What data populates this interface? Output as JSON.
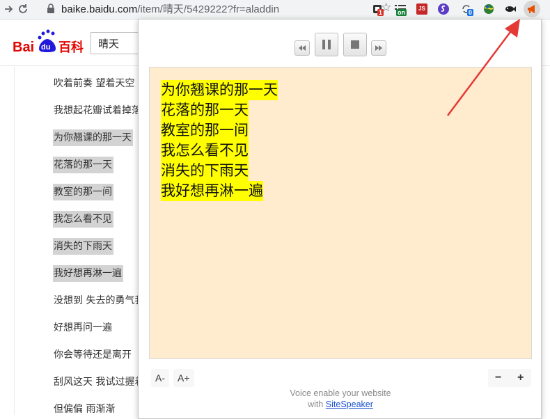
{
  "browser": {
    "url_domain": "baike.baidu.com",
    "url_path": "/item/晴天/5429222?fr=aladdin",
    "extensions": [
      {
        "icon": "mail-extension-icon",
        "badge": "1",
        "badge_color": "#d93025"
      },
      {
        "icon": "list-extension-icon",
        "badge": "on",
        "badge_color": "#188038"
      },
      {
        "icon": "js-extension-icon",
        "label": "JS",
        "color": "#c62828"
      },
      {
        "icon": "s-extension-icon",
        "color": "#5b3cc4"
      },
      {
        "icon": "refresh-extension-icon",
        "badge": "0",
        "badge_color": "#1a73e8"
      },
      {
        "icon": "globe-extension-icon"
      },
      {
        "icon": "fish-extension-icon"
      },
      {
        "icon": "megaphone-extension-icon",
        "color": "#e65100"
      }
    ]
  },
  "baidu": {
    "logo_text_latin_1": "Bai",
    "logo_text_du": "du",
    "logo_text_chinese": "百科",
    "search_value": "晴天",
    "lyrics": [
      {
        "text": "吹着前奏 望着天空",
        "highlighted": false
      },
      {
        "text": "我想起花瓣试着掉落",
        "highlighted": false
      },
      {
        "text": "为你翘课的那一天",
        "highlighted": true
      },
      {
        "text": "花落的那一天",
        "highlighted": true
      },
      {
        "text": "教室的那一间",
        "highlighted": true
      },
      {
        "text": "我怎么看不见",
        "highlighted": true
      },
      {
        "text": "消失的下雨天",
        "highlighted": true
      },
      {
        "text": "我好想再淋一遍",
        "highlighted": true
      },
      {
        "text": "没想到 失去的勇气我还留着",
        "highlighted": false
      },
      {
        "text": "好想再问一遍",
        "highlighted": false
      },
      {
        "text": "你会等待还是离开",
        "highlighted": false
      },
      {
        "text": "刮风这天 我试过握着你手",
        "highlighted": false
      },
      {
        "text": "但偏偏 雨渐渐",
        "highlighted": false
      }
    ]
  },
  "popup": {
    "reading_lines": [
      "为你翘课的那一天",
      "花落的那一天",
      "教室的那一间",
      "我怎么看不见",
      "消失的下雨天",
      "我好想再淋一遍"
    ],
    "font_decrease_label": "A-",
    "font_increase_label": "A+",
    "zoom_out_label": "−",
    "zoom_in_label": "+",
    "footer_line1": "Voice enable your website",
    "footer_with": "with",
    "footer_link": "SiteSpeaker",
    "text_background": "#ffebcd",
    "highlight_color": "#ffff00"
  },
  "annotation": {
    "color": "#e53935"
  }
}
